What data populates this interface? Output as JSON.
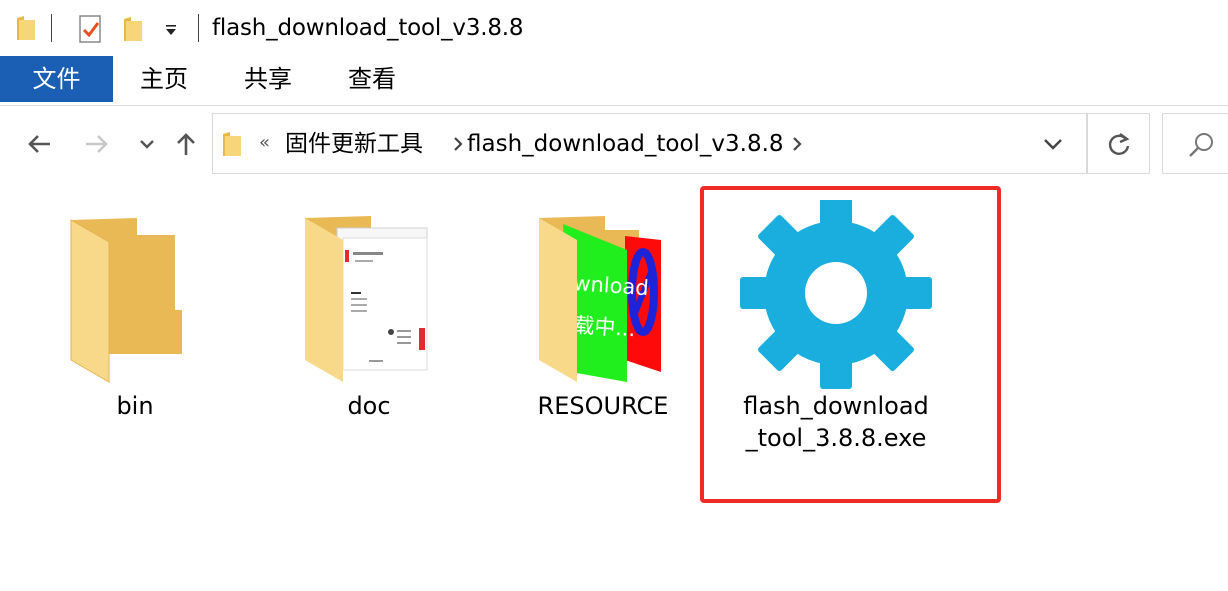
{
  "window": {
    "title": "flash_download_tool_v3.8.8"
  },
  "ribbon": {
    "tabs": [
      {
        "label": "文件"
      },
      {
        "label": "主页"
      },
      {
        "label": "共享"
      },
      {
        "label": "查看"
      }
    ]
  },
  "address_bar": {
    "overflow": "«",
    "breadcrumbs": [
      {
        "label": "固件更新工具"
      },
      {
        "label": "flash_download_tool_v3.8.8"
      }
    ]
  },
  "files": [
    {
      "name": "bin",
      "type": "folder",
      "icon": "folder-icon"
    },
    {
      "name": "doc",
      "type": "folder",
      "icon": "folder-document-icon"
    },
    {
      "name": "RESOURCE",
      "type": "folder",
      "icon": "folder-image-icon"
    },
    {
      "name": "flash_download_tool_3.8.8.exe",
      "name_lines": [
        "flash_download",
        "_tool_3.8.8.exe"
      ],
      "type": "application",
      "icon": "gear-icon",
      "highlighted": true
    }
  ],
  "thumbnails": {
    "resource_text": [
      "wnload",
      "载中..."
    ]
  },
  "colors": {
    "accent": "#1a5fb4",
    "gear": "#1aaedf",
    "highlight_border": "#ee2b24",
    "folder": "#f7d67a"
  }
}
